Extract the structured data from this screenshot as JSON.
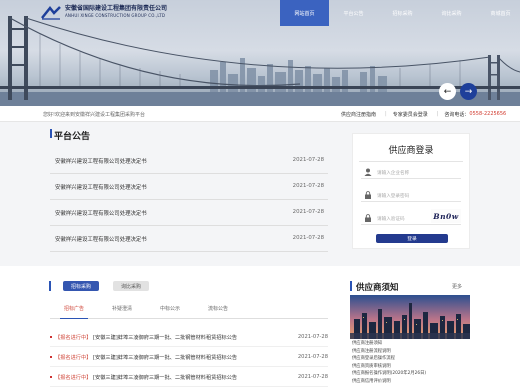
{
  "header": {
    "logo_cn": "安徽省国际建设工程集团有限责任公司",
    "logo_en": "ANHUI XINGE CONSTRUCTION GROUP CO.,LTD",
    "nav": [
      {
        "label": "网站首页",
        "active": true
      },
      {
        "label": "平台公告",
        "active": false
      },
      {
        "label": "招标采购",
        "active": false
      },
      {
        "label": "询比采购",
        "active": false
      },
      {
        "label": "商城首页",
        "active": false
      }
    ],
    "prev_icon": "arrow-left-icon",
    "next_icon": "arrow-right-icon"
  },
  "infobar": {
    "welcome": "您好!欢迎来到安徽祥兴建设工程集团采购平台",
    "link_help": "供应商注册指南",
    "link_expert": "专家委员会登录",
    "phone_label": "咨询电话：",
    "phone": "0558-2225656"
  },
  "notice": {
    "title": "平台公告",
    "items": [
      {
        "title": "安徽祥兴建设工程有限公司处理决定书",
        "date": "2021-07-28"
      },
      {
        "title": "安徽祥兴建设工程有限公司处理决定书",
        "date": "2021-07-28"
      },
      {
        "title": "安徽祥兴建设工程有限公司处理决定书",
        "date": "2021-07-28"
      },
      {
        "title": "安徽祥兴建设工程有限公司处理决定书",
        "date": "2021-07-28"
      }
    ]
  },
  "login": {
    "title": "供应商登录",
    "user_placeholder": "请输入企业名称",
    "pass_placeholder": "请输入登录密码",
    "code_placeholder": "请输入验证码",
    "captcha": "Bn0w",
    "submit": "登录"
  },
  "procurement": {
    "tab_active": "招标采购",
    "tab_other": "询比采购",
    "subtabs": [
      "招标广告",
      "补疑澄清",
      "中标公示",
      "流标公告"
    ],
    "rows": [
      {
        "tag": "【报名进行中】",
        "title": "[安徽三建]蚌埠三凌御府三期一批、二批钢管材料租赁招标公告",
        "date": "2021-07-28"
      },
      {
        "tag": "【报名进行中】",
        "title": "[安徽三建]蚌埠三凌御府三期一批、二批钢管材料租赁招标公告",
        "date": "2021-07-28"
      },
      {
        "tag": "【报名进行中】",
        "title": "[安徽三建]蚌埠三凌御府三期一批、二批钢管材料租赁招标公告",
        "date": "2021-07-28"
      }
    ]
  },
  "supplier": {
    "title": "供应商须知",
    "more": "更多",
    "items": [
      "供应商注册须知",
      "供应商注册流程说明",
      "供应商登录后操作流程",
      "供应商资质审核说明",
      "供应商报名操作说明(2020年2月26日)",
      "供应商信用评价说明"
    ]
  }
}
